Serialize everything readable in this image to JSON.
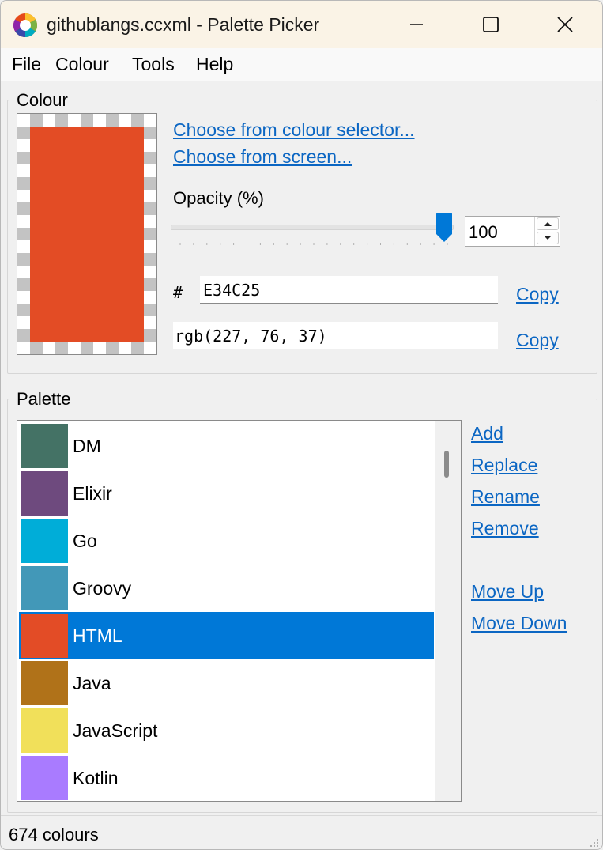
{
  "window": {
    "title": "githublangs.ccxml - Palette Picker",
    "icon": "colour-wheel-icon"
  },
  "menu": [
    "File",
    "Colour",
    "Tools",
    "Help"
  ],
  "colour_panel": {
    "heading": "Colour",
    "current_colour": "#E34C25",
    "choose_selector_label": "Choose from colour selector...",
    "choose_screen_label": "Choose from screen...",
    "opacity_label": "Opacity (%)",
    "opacity_value": "100",
    "opacity_fraction": 1.0,
    "hash_label": "#",
    "hex_value": "E34C25",
    "rgb_value": "rgb(227, 76, 37)",
    "copy_label": "Copy"
  },
  "palette_panel": {
    "heading": "Palette",
    "items": [
      {
        "name": "DM",
        "color": "#447265"
      },
      {
        "name": "Elixir",
        "color": "#6E4A7E"
      },
      {
        "name": "Go",
        "color": "#00ADD8"
      },
      {
        "name": "Groovy",
        "color": "#4298B8"
      },
      {
        "name": "HTML",
        "color": "#E34C26"
      },
      {
        "name": "Java",
        "color": "#B07219"
      },
      {
        "name": "JavaScript",
        "color": "#F1E05A"
      },
      {
        "name": "Kotlin",
        "color": "#A97BFF"
      }
    ],
    "selected_index": 4,
    "actions": {
      "add": "Add",
      "replace": "Replace",
      "rename": "Rename",
      "remove": "Remove",
      "move_up": "Move Up",
      "move_down": "Move Down"
    }
  },
  "status": {
    "count_text": "674 colours"
  },
  "colors": {
    "accent": "#0078D7",
    "link": "#0B66C3",
    "titlebar": "#FAF3E6"
  }
}
